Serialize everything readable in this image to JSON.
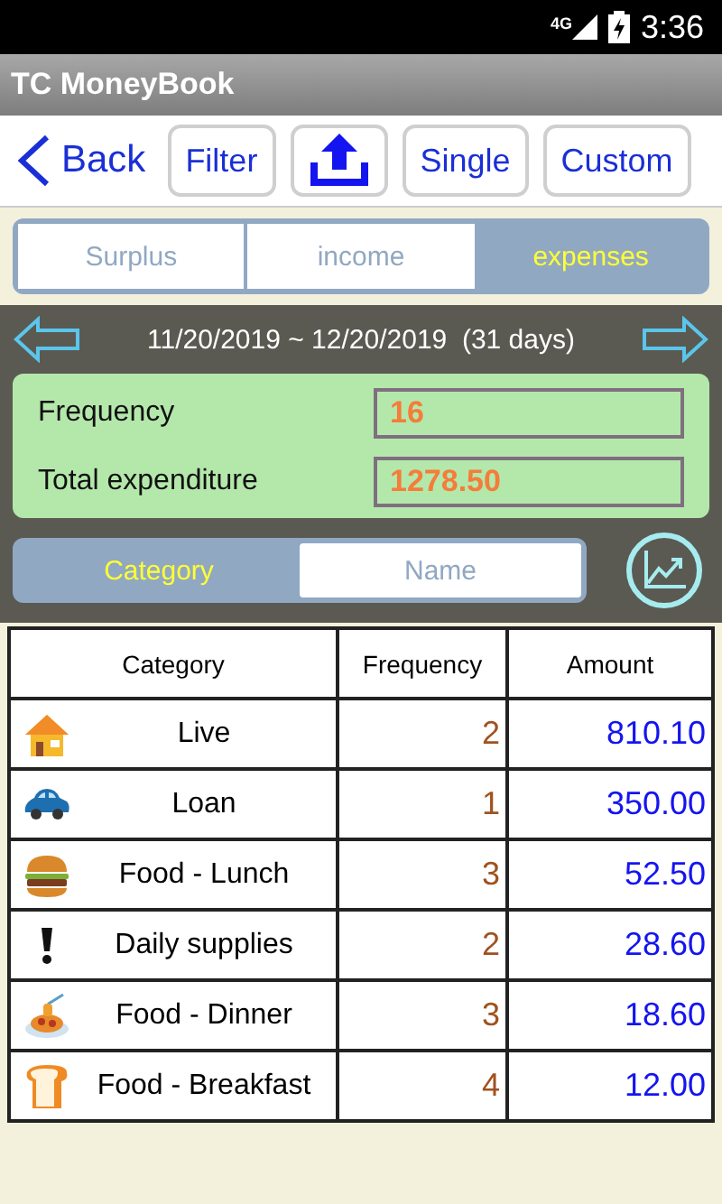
{
  "status_bar": {
    "network": "4G",
    "time": "3:36"
  },
  "app_bar": {
    "title": "TC MoneyBook"
  },
  "toolbar": {
    "back": "Back",
    "buttons": [
      {
        "kind": "text",
        "label": "Filter"
      },
      {
        "kind": "upload"
      },
      {
        "kind": "text",
        "label": "Single"
      },
      {
        "kind": "text",
        "label": "Custom"
      }
    ]
  },
  "tabs": [
    {
      "label": "Surplus",
      "selected": false
    },
    {
      "label": "income",
      "selected": false
    },
    {
      "label": "expenses",
      "selected": true
    }
  ],
  "period": "11/20/2019 ~ 12/20/2019  (31 days)",
  "summary": [
    {
      "label": "Frequency",
      "value": "16"
    },
    {
      "label": "Total expenditure",
      "value": "1278.50"
    }
  ],
  "group_tabs": [
    {
      "label": "Category",
      "selected": true
    },
    {
      "label": "Name",
      "selected": false
    }
  ],
  "table": {
    "columns": [
      "Category",
      "Frequency",
      "Amount"
    ],
    "rows": [
      {
        "kind": "house",
        "category": "Live",
        "frequency": "2",
        "amount": "810.10"
      },
      {
        "kind": "car",
        "category": "Loan",
        "frequency": "1",
        "amount": "350.00"
      },
      {
        "kind": "burger",
        "category": "Food - Lunch",
        "frequency": "3",
        "amount": "52.50"
      },
      {
        "kind": "exclamation",
        "category": "Daily supplies",
        "frequency": "2",
        "amount": "28.60"
      },
      {
        "kind": "spaghetti",
        "category": "Food - Dinner",
        "frequency": "3",
        "amount": "18.60"
      },
      {
        "kind": "bread",
        "category": "Food - Breakfast",
        "frequency": "4",
        "amount": "12.00"
      }
    ]
  }
}
